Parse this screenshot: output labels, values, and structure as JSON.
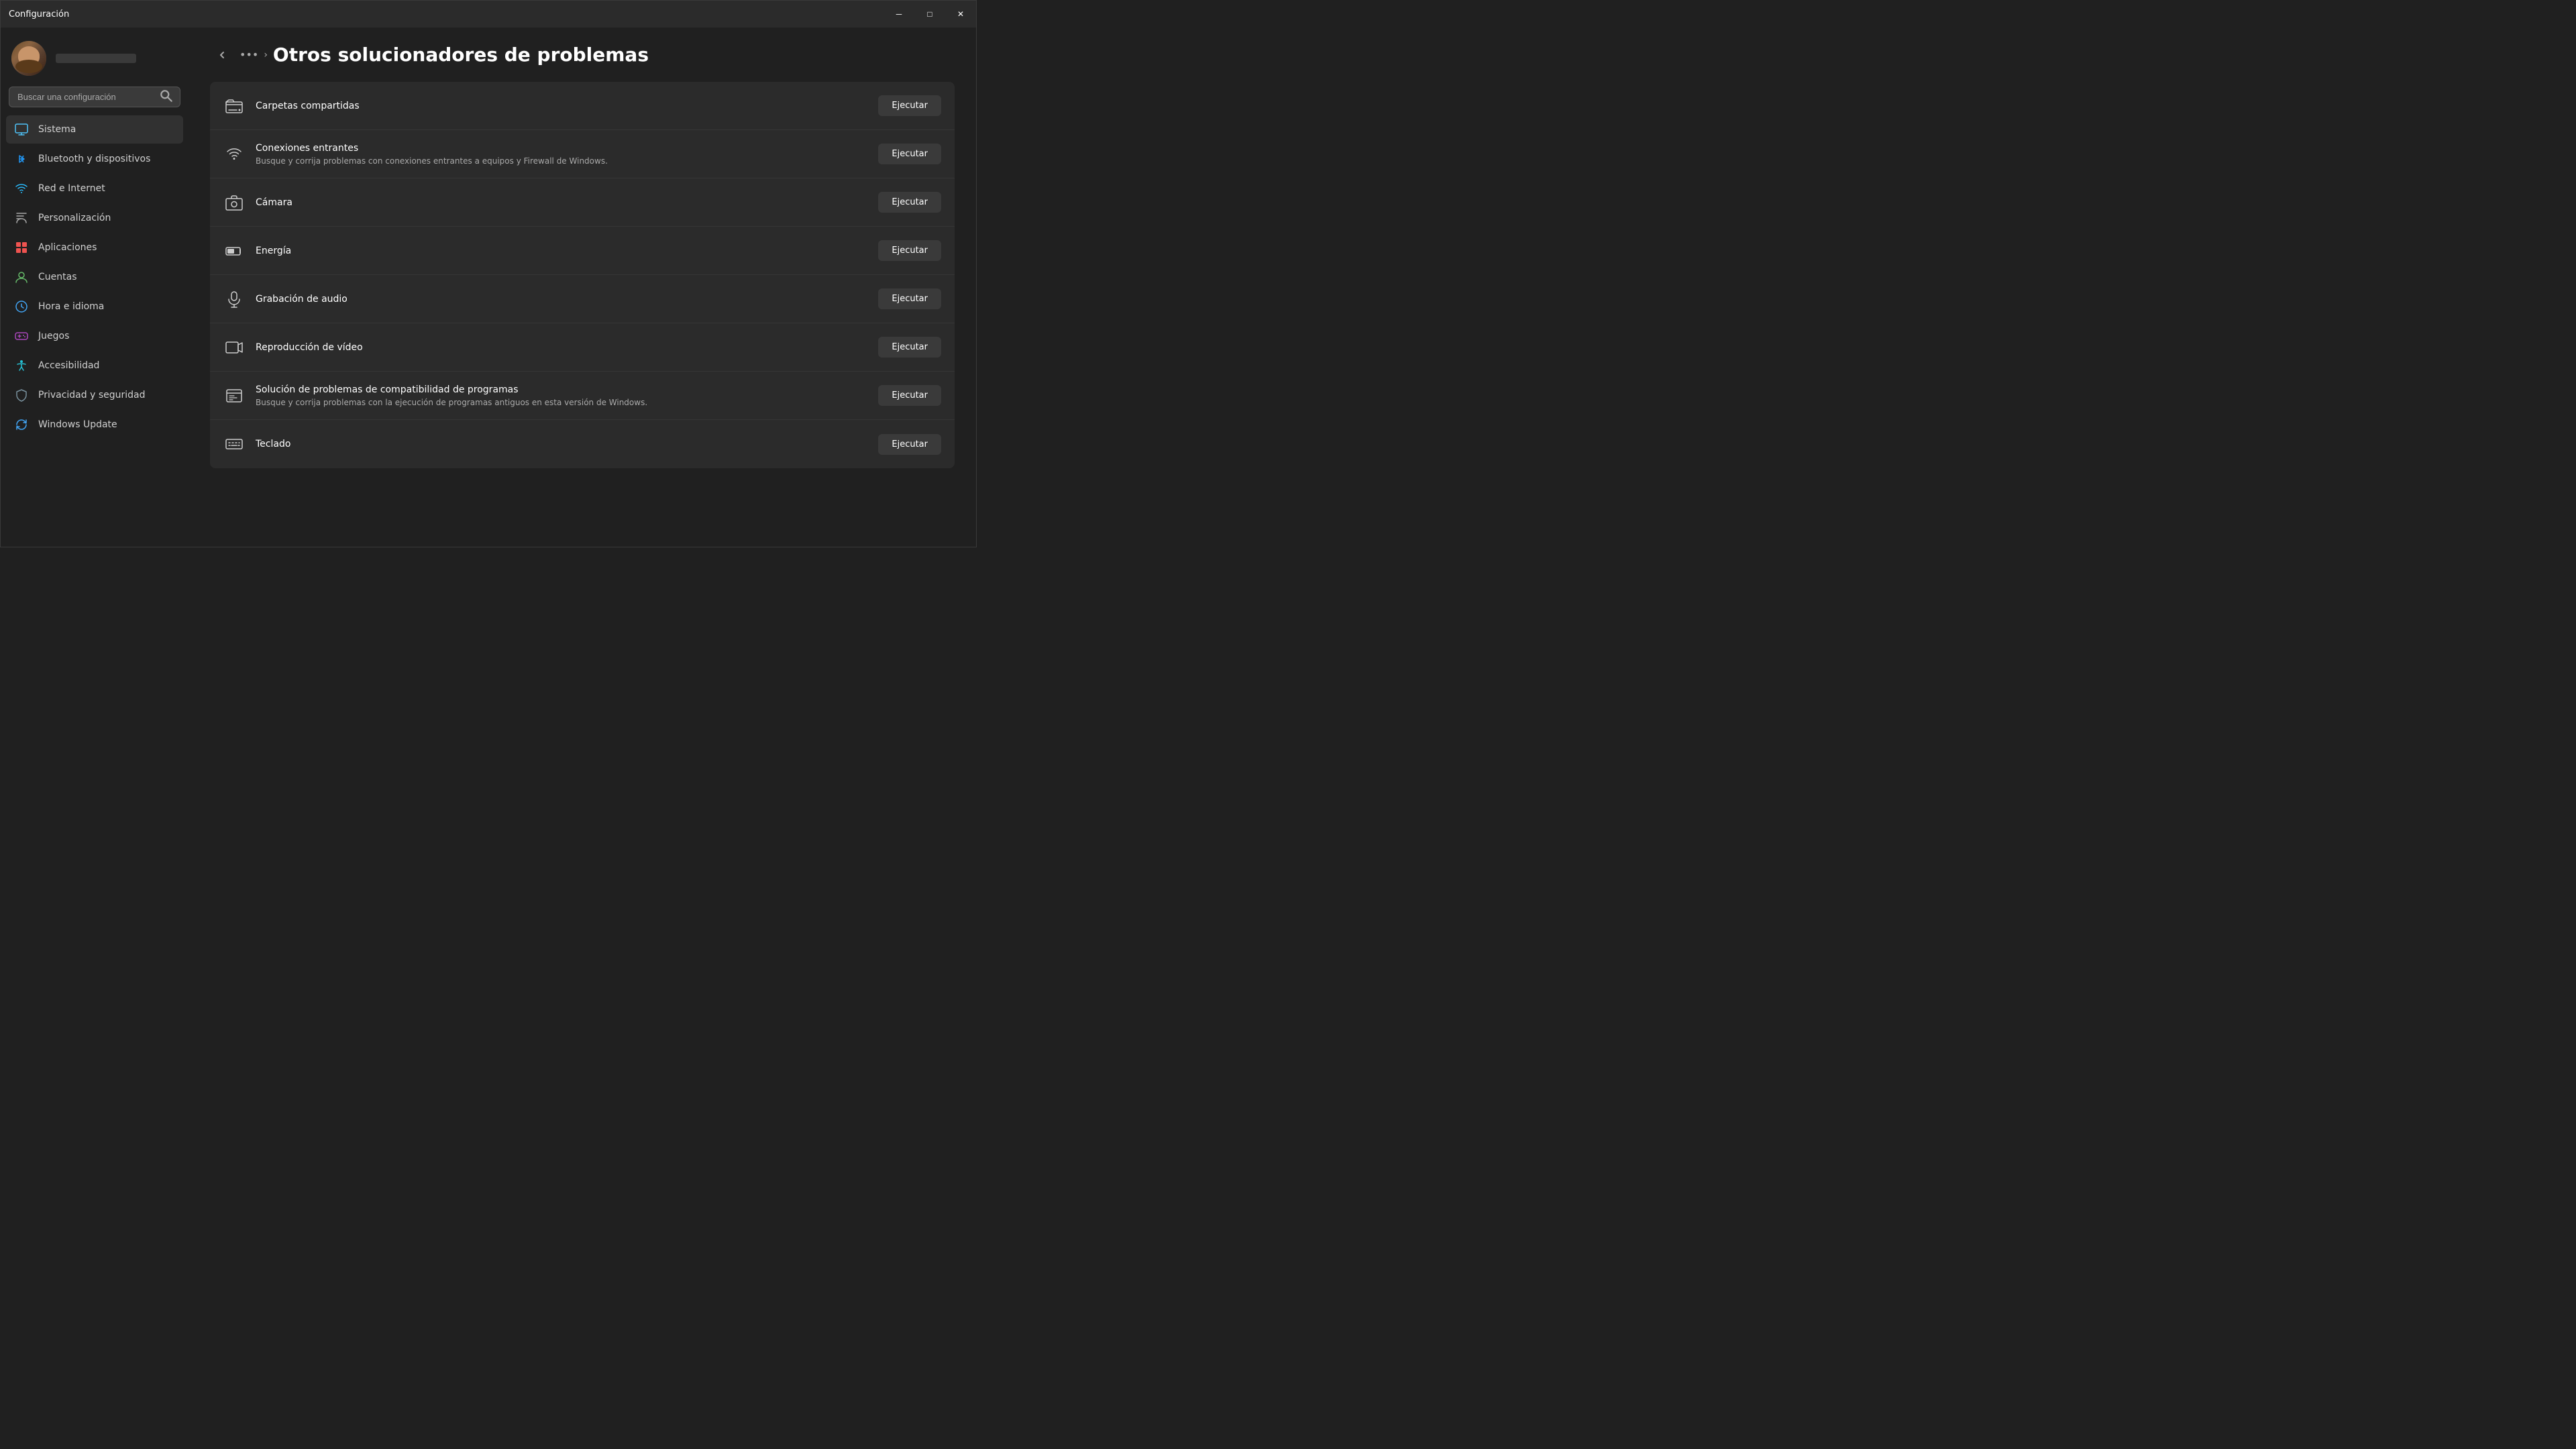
{
  "window": {
    "title": "Configuración",
    "minimize_label": "─",
    "maximize_label": "□",
    "close_label": "✕"
  },
  "sidebar": {
    "search_placeholder": "Buscar una configuración",
    "user_name_blurred": true,
    "nav_items": [
      {
        "id": "sistema",
        "label": "Sistema",
        "icon": "sistema",
        "active": true
      },
      {
        "id": "bluetooth",
        "label": "Bluetooth y dispositivos",
        "icon": "bluetooth",
        "active": false
      },
      {
        "id": "red",
        "label": "Red e Internet",
        "icon": "red",
        "active": false
      },
      {
        "id": "personalizacion",
        "label": "Personalización",
        "icon": "personalizacion",
        "active": false
      },
      {
        "id": "aplicaciones",
        "label": "Aplicaciones",
        "icon": "aplicaciones",
        "active": false
      },
      {
        "id": "cuentas",
        "label": "Cuentas",
        "icon": "cuentas",
        "active": false
      },
      {
        "id": "hora",
        "label": "Hora e idioma",
        "icon": "hora",
        "active": false
      },
      {
        "id": "juegos",
        "label": "Juegos",
        "icon": "juegos",
        "active": false
      },
      {
        "id": "accesibilidad",
        "label": "Accesibilidad",
        "icon": "accesibilidad",
        "active": false
      },
      {
        "id": "privacidad",
        "label": "Privacidad y seguridad",
        "icon": "privacidad",
        "active": false
      },
      {
        "id": "update",
        "label": "Windows Update",
        "icon": "update",
        "active": false
      }
    ]
  },
  "main": {
    "breadcrumb_dots": "•••",
    "breadcrumb_chevron": "›",
    "page_title": "Otros solucionadores de problemas",
    "items": [
      {
        "id": "carpetas",
        "name": "Carpetas compartidas",
        "desc": "",
        "icon": "folder-network",
        "button": "Ejecutar"
      },
      {
        "id": "conexiones",
        "name": "Conexiones entrantes",
        "desc": "Busque y corrija problemas con conexiones entrantes a equipos y Firewall de Windows.",
        "icon": "wifi-incoming",
        "button": "Ejecutar"
      },
      {
        "id": "camara",
        "name": "Cámara",
        "desc": "",
        "icon": "camera",
        "button": "Ejecutar"
      },
      {
        "id": "energia",
        "name": "Energía",
        "desc": "",
        "icon": "battery",
        "button": "Ejecutar"
      },
      {
        "id": "grabacion",
        "name": "Grabación de audio",
        "desc": "",
        "icon": "microphone",
        "button": "Ejecutar"
      },
      {
        "id": "reproduccion",
        "name": "Reproducción de vídeo",
        "desc": "",
        "icon": "video",
        "button": "Ejecutar"
      },
      {
        "id": "compatibilidad",
        "name": "Solución de problemas de compatibilidad de programas",
        "desc": "Busque y corrija problemas con la ejecución de programas antiguos en esta versión de Windows.",
        "icon": "compat",
        "button": "Ejecutar"
      },
      {
        "id": "teclado",
        "name": "Teclado",
        "desc": "",
        "icon": "keyboard",
        "button": "Ejecutar"
      }
    ]
  }
}
